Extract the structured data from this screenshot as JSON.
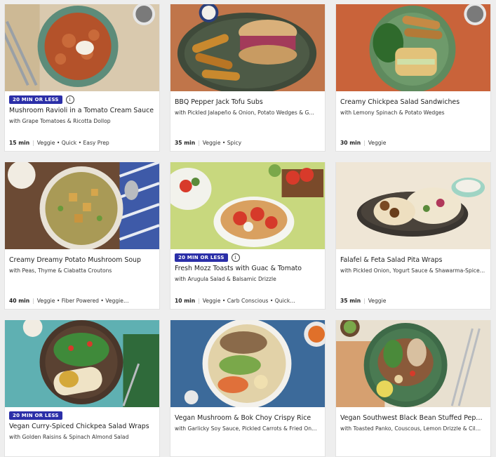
{
  "cards": [
    {
      "badge": "20 MIN OR LESS",
      "title": "Mushroom Ravioli in a Tomato Cream Sauce",
      "subtitle": "with Grape Tomatoes & Ricotta Dollop",
      "time": "15 min",
      "tags": "Veggie • Quick • Easy Prep"
    },
    {
      "badge": "",
      "title": "BBQ Pepper Jack Tofu Subs",
      "subtitle": "with Pickled Jalapeño & Onion, Potato Wedges & G…",
      "time": "35 min",
      "tags": "Veggie • Spicy"
    },
    {
      "badge": "",
      "title": "Creamy Chickpea Salad Sandwiches",
      "subtitle": "with Lemony Spinach & Potato Wedges",
      "time": "30 min",
      "tags": "Veggie"
    },
    {
      "badge": "",
      "title": "Creamy Dreamy Potato Mushroom Soup",
      "subtitle": "with Peas, Thyme & Ciabatta Croutons",
      "time": "40 min",
      "tags": "Veggie • Fiber Powered • Veggie…"
    },
    {
      "badge": "20 MIN OR LESS",
      "title": "Fresh Mozz Toasts with Guac & Tomato",
      "subtitle": "with Arugula Salad & Balsamic Drizzle",
      "time": "10 min",
      "tags": "Veggie • Carb Conscious • Quick…"
    },
    {
      "badge": "",
      "title": "Falafel & Feta Salad Pita Wraps",
      "subtitle": "with Pickled Onion, Yogurt Sauce & Shawarma-Spice…",
      "time": "35 min",
      "tags": "Veggie"
    },
    {
      "badge": "20 MIN OR LESS",
      "title": "Vegan Curry-Spiced Chickpea Salad Wraps",
      "subtitle": "with Golden Raisins & Spinach Almond Salad",
      "time": "",
      "tags": ""
    },
    {
      "badge": "",
      "title": "Vegan Mushroom & Bok Choy Crispy Rice",
      "subtitle": "with Garlicky Soy Sauce, Pickled Carrots & Fried On…",
      "time": "",
      "tags": ""
    },
    {
      "badge": "",
      "title": "Vegan Southwest Black Bean Stuffed Pepp…",
      "subtitle": "with Toasted Panko, Couscous, Lemon Drizzle & Cil…",
      "time": "",
      "tags": ""
    }
  ],
  "icons": {
    "info": "info-icon"
  },
  "colors": {
    "badge": "#2b2fa8"
  }
}
